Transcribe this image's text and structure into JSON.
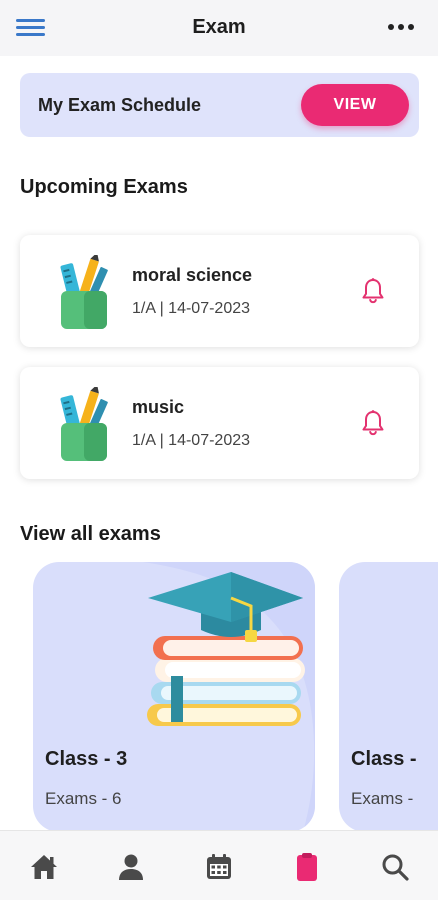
{
  "header": {
    "title": "Exam",
    "menu_icon": "hamburger-menu-icon",
    "more_icon": "more-dots-icon"
  },
  "schedule": {
    "title": "My Exam Schedule",
    "button_label": "VIEW"
  },
  "upcoming": {
    "heading": "Upcoming Exams",
    "items": [
      {
        "name": "moral science",
        "meta": "1/A | 14-07-2023",
        "icon": "pencil-cup-icon",
        "action_icon": "bell-icon"
      },
      {
        "name": "music",
        "meta": "1/A | 14-07-2023",
        "icon": "pencil-cup-icon",
        "action_icon": "bell-icon"
      }
    ]
  },
  "all_exams": {
    "heading": "View all exams",
    "cards": [
      {
        "name": "Class - 3",
        "count_text": "Exams - 6",
        "icon": "graduation-cap-books-icon"
      },
      {
        "name": "Class - ",
        "count_text": "Exams - "
      }
    ]
  },
  "bottom_nav": {
    "items": [
      {
        "icon": "home-icon"
      },
      {
        "icon": "profile-icon"
      },
      {
        "icon": "calendar-icon"
      },
      {
        "icon": "clipboard-icon",
        "active": true
      },
      {
        "icon": "search-icon"
      }
    ]
  },
  "colors": {
    "accent": "#ea2a73",
    "card_lavender": "#dfe3fb",
    "menu_blue": "#3a78c9",
    "nav_icon": "#4a4a4a"
  }
}
